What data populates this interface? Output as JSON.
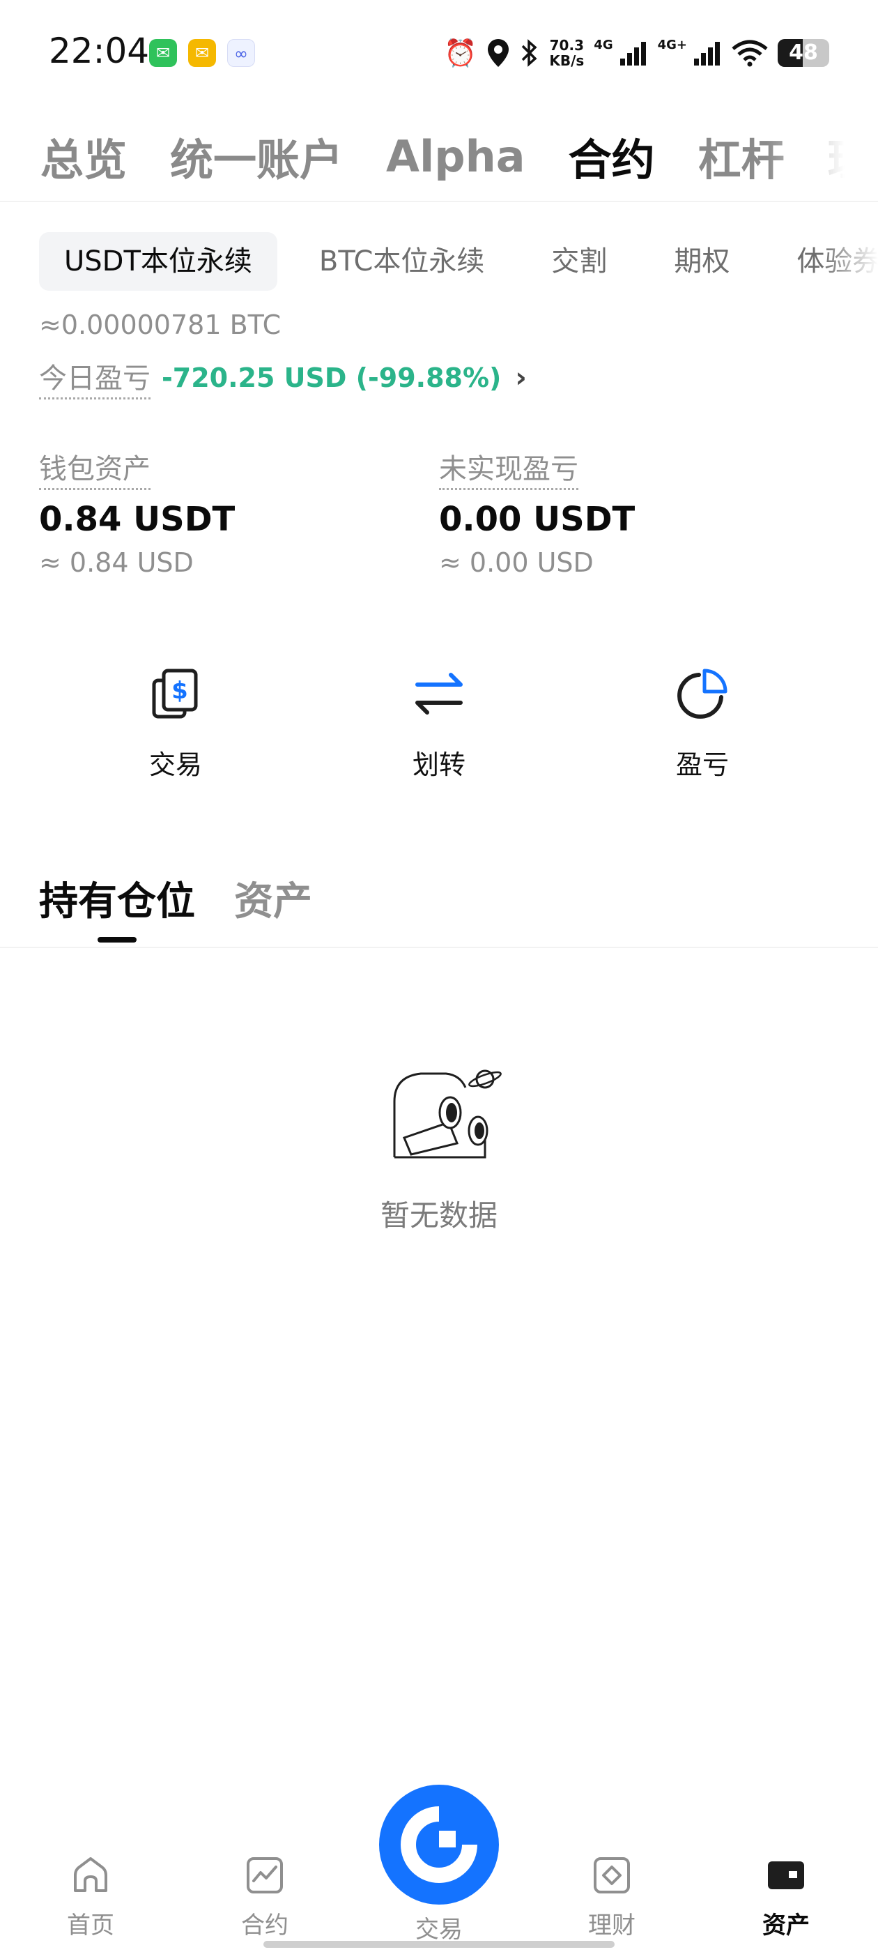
{
  "status_bar": {
    "time": "22:04",
    "net_speed_value": "70.3",
    "net_speed_unit": "KB/s",
    "signal1_label": "4G",
    "signal2_label": "4G+",
    "battery": "48",
    "battery_level": 0.48
  },
  "top_nav": {
    "tabs": [
      "总览",
      "统一账户",
      "Alpha",
      "合约",
      "杠杆",
      "理"
    ],
    "active_index": 3
  },
  "sub_tabs": {
    "tabs": [
      "USDT本位永续",
      "BTC本位永续",
      "交割",
      "期权",
      "体验券"
    ],
    "active_index": 0
  },
  "summary": {
    "btc_equivalent": "≈0.00000781 BTC",
    "pnl_label": "今日盈亏",
    "pnl_value": "-720.25 USD (-99.88%)",
    "pnl_color": "#2bb48a"
  },
  "wallet": {
    "label": "钱包资产",
    "value": "0.84 USDT",
    "usd": "≈ 0.84 USD"
  },
  "unrealized": {
    "label": "未实现盈亏",
    "value": "0.00 USDT",
    "usd": "≈ 0.00 USD"
  },
  "actions": [
    {
      "label": "交易",
      "icon": "trade-dollar-icon"
    },
    {
      "label": "划转",
      "icon": "transfer-arrows-icon"
    },
    {
      "label": "盈亏",
      "icon": "pie-chart-icon"
    }
  ],
  "position_tabs": {
    "tabs": [
      "持有仓位",
      "资产"
    ],
    "active_index": 0
  },
  "empty_state": {
    "text": "暂无数据",
    "icon": "binoculars-planet-icon"
  },
  "bottom_nav": {
    "items": [
      {
        "label": "首页",
        "icon": "home-icon"
      },
      {
        "label": "合约",
        "icon": "futures-chart-icon"
      },
      {
        "label": "交易",
        "icon": "trade-logo-icon"
      },
      {
        "label": "理财",
        "icon": "earn-diamond-icon"
      },
      {
        "label": "资产",
        "icon": "wallet-icon"
      }
    ],
    "active_index": 4
  },
  "colors": {
    "accent": "#1473ff",
    "profit_green": "#2bb48a"
  }
}
